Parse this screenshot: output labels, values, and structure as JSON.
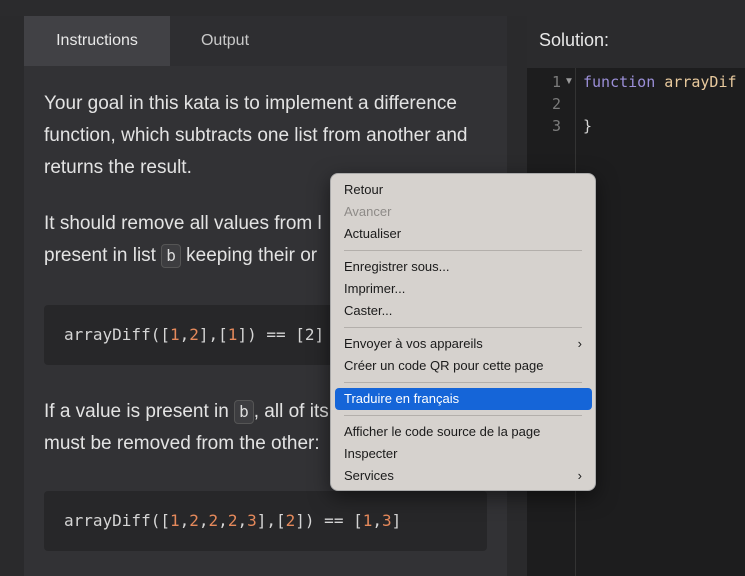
{
  "instructions_panel": {
    "tabs": {
      "instructions": "Instructions",
      "output": "Output"
    },
    "para1": "Your goal in this kata is to implement a difference function, which subtracts one list from another and returns the result.",
    "para2": {
      "before": "It should remove all values from l",
      "line2_before": "present in list ",
      "code": "b",
      "line2_after": " keeping their or"
    },
    "code1": {
      "prefix": "arrayDiff([",
      "a": "1",
      "c1": ",",
      "b": "2",
      "mid": "],[",
      "c": "1",
      "suffix": "]) == [2]"
    },
    "para3": {
      "before": "If a value is present in ",
      "code": "b",
      "after": ", all of its",
      "line2": "must be removed from the other:"
    },
    "code2": {
      "p1": "arrayDiff([",
      "v1": "1",
      "s1": ",",
      "v2": "2",
      "s2": ",",
      "v3": "2",
      "s3": ",",
      "v4": "2",
      "s4": ",",
      "v5": "3",
      "p2": "],[",
      "v6": "2",
      "p3": "]) == [",
      "v7": "1",
      "s5": ",",
      "v8": "3",
      "p4": "]"
    }
  },
  "solution_panel": {
    "title": "Solution:",
    "lines": [
      {
        "num": "1",
        "keyword": "function",
        "name": " arrayDif"
      },
      {
        "num": "2",
        "text": ""
      },
      {
        "num": "3",
        "text": "}"
      }
    ]
  },
  "context_menu": {
    "back": "Retour",
    "forward": "Avancer",
    "reload": "Actualiser",
    "save_as": "Enregistrer sous...",
    "print": "Imprimer...",
    "cast": "Caster...",
    "send_to_devices": "Envoyer à vos appareils",
    "qr_code": "Créer un code QR pour cette page",
    "translate": "Traduire en français",
    "view_source": "Afficher le code source de la page",
    "inspect": "Inspecter",
    "services": "Services",
    "submenu_chevron": "›"
  }
}
